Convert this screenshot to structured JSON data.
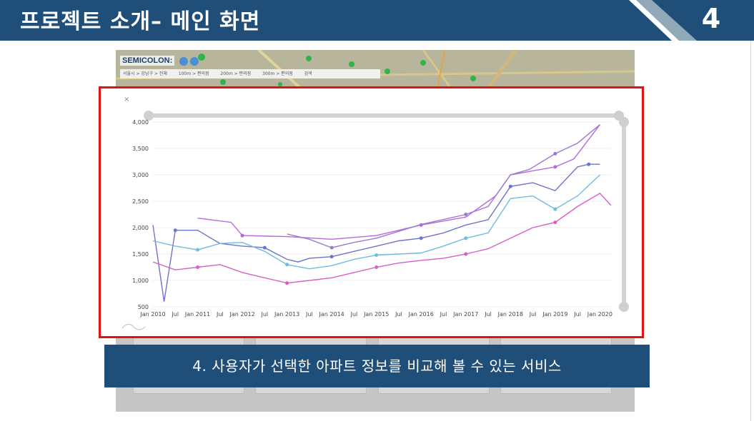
{
  "slide": {
    "title": "프로젝트 소개– 메인 화면",
    "page_number": "4",
    "caption": "4. 사용자가 선택한 아파트 정보를 비교해 볼 수 있는 서비스",
    "colors": {
      "header": "#1f4e79",
      "accent": "#8fa9b8",
      "highlight": "#e41111"
    }
  },
  "app": {
    "logo": "SEMICOLON:",
    "location": [
      "서울시 > 강남구 > 전체",
      "100m > 편의점",
      "200m > 편의점",
      "300m > 편의점",
      "검색"
    ],
    "close_icon": "×"
  },
  "chart_data": {
    "type": "line",
    "x_ticks": [
      "Jan 2010",
      "Jul",
      "Jan 2011",
      "Jul",
      "Jan 2012",
      "Jul",
      "Jan 2013",
      "Jul",
      "Jan 2014",
      "Jul",
      "Jan 2015",
      "Jul",
      "Jan 2016",
      "Jul",
      "Jan 2017",
      "Jul",
      "Jan 2018",
      "Jul",
      "Jan 2019",
      "Jul",
      "Jan 2020"
    ],
    "y_ticks": [
      "4,000",
      "3,500",
      "3,000",
      "2,500",
      "2,000",
      "1,500",
      "1,000",
      "500"
    ],
    "ylim": [
      500,
      4000
    ],
    "xlim": [
      "2010-01",
      "2020-04"
    ],
    "grid": true,
    "series": [
      {
        "color": "#b36bdc",
        "points": [
          [
            "2011-01",
            2180
          ],
          [
            "2011-10",
            2100
          ],
          [
            "2012-01",
            1850
          ],
          [
            "2013-01",
            1830
          ],
          [
            "2014-01",
            1780
          ],
          [
            "2015-01",
            1850
          ],
          [
            "2016-01",
            2050
          ],
          [
            "2017-01",
            2200
          ],
          [
            "2017-09",
            2600
          ],
          [
            "2018-01",
            3000
          ],
          [
            "2019-01",
            3150
          ],
          [
            "2019-06",
            3300
          ],
          [
            "2020-01",
            3950
          ]
        ]
      },
      {
        "color": "#9b7ad0",
        "points": [
          [
            "2013-01",
            1880
          ],
          [
            "2013-07",
            1780
          ],
          [
            "2014-01",
            1620
          ],
          [
            "2014-07",
            1720
          ],
          [
            "2015-01",
            1800
          ],
          [
            "2016-01",
            2060
          ],
          [
            "2017-01",
            2250
          ],
          [
            "2017-07",
            2400
          ],
          [
            "2018-01",
            3000
          ],
          [
            "2018-06",
            3100
          ],
          [
            "2019-01",
            3400
          ],
          [
            "2019-07",
            3600
          ],
          [
            "2020-01",
            3950
          ]
        ]
      },
      {
        "color": "#6d74c9",
        "points": [
          [
            "2010-01",
            2050
          ],
          [
            "2010-04",
            600
          ],
          [
            "2010-07",
            1950
          ],
          [
            "2011-01",
            1950
          ],
          [
            "2011-07",
            1700
          ],
          [
            "2012-01",
            1650
          ],
          [
            "2012-07",
            1620
          ],
          [
            "2013-01",
            1400
          ],
          [
            "2013-04",
            1350
          ],
          [
            "2013-07",
            1420
          ],
          [
            "2014-01",
            1450
          ],
          [
            "2014-07",
            1550
          ],
          [
            "2015-01",
            1650
          ],
          [
            "2015-07",
            1750
          ],
          [
            "2016-01",
            1800
          ],
          [
            "2016-07",
            1900
          ],
          [
            "2017-01",
            2050
          ],
          [
            "2017-07",
            2150
          ],
          [
            "2018-01",
            2780
          ],
          [
            "2018-07",
            2850
          ],
          [
            "2019-01",
            2700
          ],
          [
            "2019-07",
            3150
          ],
          [
            "2019-10",
            3200
          ],
          [
            "2020-01",
            3200
          ]
        ]
      },
      {
        "color": "#6fbcde",
        "points": [
          [
            "2010-01",
            1750
          ],
          [
            "2010-07",
            1650
          ],
          [
            "2011-01",
            1580
          ],
          [
            "2011-07",
            1700
          ],
          [
            "2012-01",
            1720
          ],
          [
            "2012-07",
            1550
          ],
          [
            "2013-01",
            1300
          ],
          [
            "2013-07",
            1220
          ],
          [
            "2014-01",
            1280
          ],
          [
            "2014-07",
            1400
          ],
          [
            "2015-01",
            1480
          ],
          [
            "2015-07",
            1500
          ],
          [
            "2016-01",
            1520
          ],
          [
            "2016-07",
            1650
          ],
          [
            "2017-01",
            1800
          ],
          [
            "2017-07",
            1900
          ],
          [
            "2018-01",
            2550
          ],
          [
            "2018-07",
            2600
          ],
          [
            "2019-01",
            2350
          ],
          [
            "2019-07",
            2600
          ],
          [
            "2020-01",
            3000
          ]
        ]
      },
      {
        "color": "#d95fc5",
        "points": [
          [
            "2010-01",
            1350
          ],
          [
            "2010-07",
            1200
          ],
          [
            "2011-01",
            1250
          ],
          [
            "2011-07",
            1300
          ],
          [
            "2012-01",
            1150
          ],
          [
            "2012-07",
            1050
          ],
          [
            "2013-01",
            950
          ],
          [
            "2013-07",
            1000
          ],
          [
            "2014-01",
            1050
          ],
          [
            "2014-07",
            1150
          ],
          [
            "2015-01",
            1250
          ],
          [
            "2015-07",
            1330
          ],
          [
            "2016-01",
            1380
          ],
          [
            "2016-07",
            1420
          ],
          [
            "2017-01",
            1500
          ],
          [
            "2017-07",
            1600
          ],
          [
            "2018-01",
            1800
          ],
          [
            "2018-07",
            2000
          ],
          [
            "2019-01",
            2100
          ],
          [
            "2019-07",
            2400
          ],
          [
            "2020-01",
            2650
          ],
          [
            "2020-04",
            2420
          ]
        ]
      }
    ]
  }
}
